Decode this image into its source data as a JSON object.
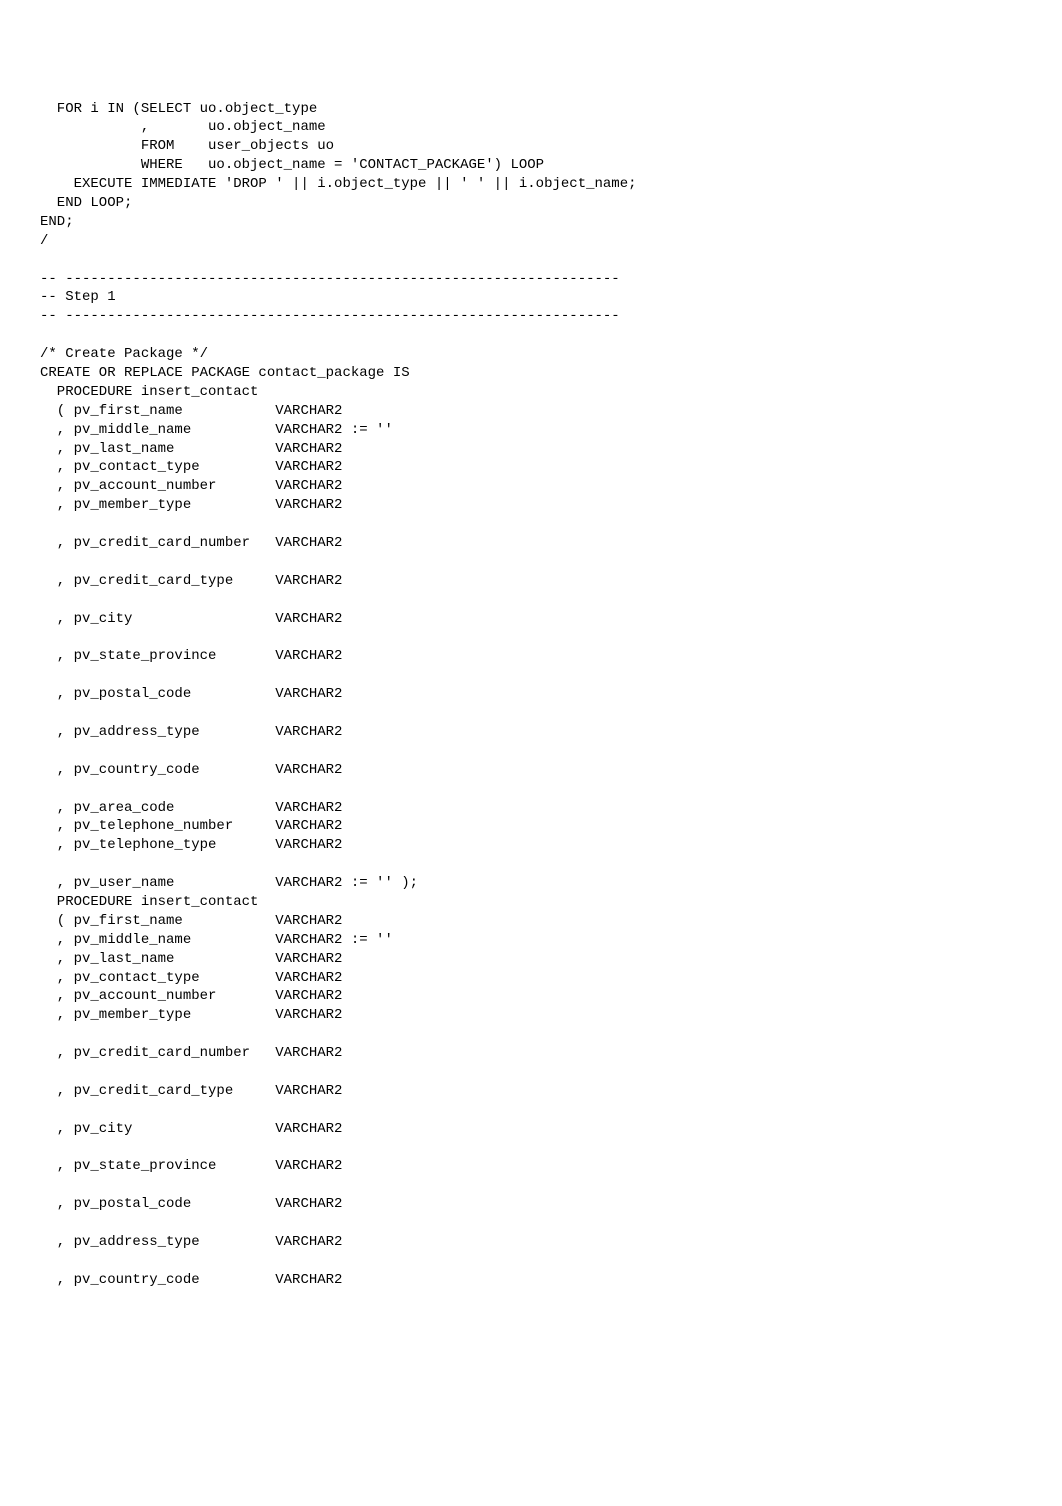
{
  "code": "  FOR i IN (SELECT uo.object_type\n            ,       uo.object_name\n            FROM    user_objects uo\n            WHERE   uo.object_name = 'CONTACT_PACKAGE') LOOP\n    EXECUTE IMMEDIATE 'DROP ' || i.object_type || ' ' || i.object_name;\n  END LOOP;\nEND;\n/\n\n-- ------------------------------------------------------------------\n-- Step 1\n-- ------------------------------------------------------------------\n\n/* Create Package */\nCREATE OR REPLACE PACKAGE contact_package IS\n  PROCEDURE insert_contact\n  ( pv_first_name           VARCHAR2\n  , pv_middle_name          VARCHAR2 := ''\n  , pv_last_name            VARCHAR2\n  , pv_contact_type         VARCHAR2\n  , pv_account_number       VARCHAR2\n  , pv_member_type          VARCHAR2\n\n  , pv_credit_card_number   VARCHAR2\n\n  , pv_credit_card_type     VARCHAR2\n\n  , pv_city                 VARCHAR2\n\n  , pv_state_province       VARCHAR2\n\n  , pv_postal_code          VARCHAR2\n\n  , pv_address_type         VARCHAR2\n\n  , pv_country_code         VARCHAR2\n\n  , pv_area_code            VARCHAR2\n  , pv_telephone_number     VARCHAR2\n  , pv_telephone_type       VARCHAR2\n\n  , pv_user_name            VARCHAR2 := '' );\n  PROCEDURE insert_contact\n  ( pv_first_name           VARCHAR2\n  , pv_middle_name          VARCHAR2 := ''\n  , pv_last_name            VARCHAR2\n  , pv_contact_type         VARCHAR2\n  , pv_account_number       VARCHAR2\n  , pv_member_type          VARCHAR2\n\n  , pv_credit_card_number   VARCHAR2\n\n  , pv_credit_card_type     VARCHAR2\n\n  , pv_city                 VARCHAR2\n\n  , pv_state_province       VARCHAR2\n\n  , pv_postal_code          VARCHAR2\n\n  , pv_address_type         VARCHAR2\n\n  , pv_country_code         VARCHAR2"
}
